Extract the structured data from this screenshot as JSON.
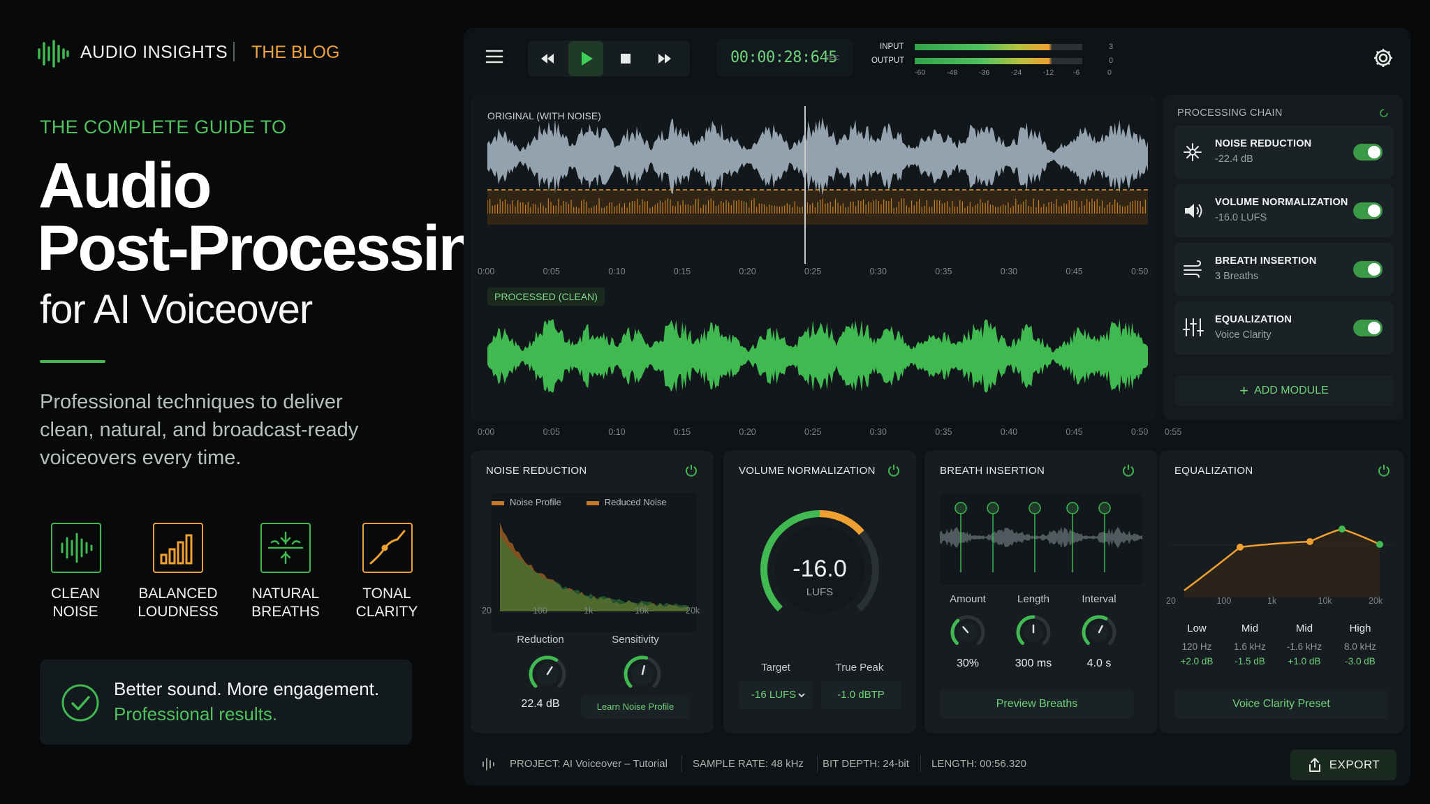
{
  "brand": {
    "name": "AUDIO INSIGHTS",
    "section": "THE BLOG"
  },
  "hero": {
    "kicker": "THE COMPLETE GUIDE TO",
    "title_line1": "Audio",
    "title_line2": "Post-Processing",
    "title_line3": "for AI Voiceover",
    "description_lines": [
      "Professional techniques to deliver",
      "clean, natural, and broadcast-ready",
      "voiceovers every time."
    ]
  },
  "features": [
    {
      "line1": "CLEAN",
      "line2": "NOISE",
      "icon": "waveform-icon",
      "color": "#3fb950"
    },
    {
      "line1": "BALANCED",
      "line2": "LOUDNESS",
      "icon": "bars-icon",
      "color": "#f0a030"
    },
    {
      "line1": "NATURAL",
      "line2": "BREATHS",
      "icon": "breath-icon",
      "color": "#3fb950"
    },
    {
      "line1": "TONAL",
      "line2": "CLARITY",
      "icon": "eq-curve-icon",
      "color": "#f0a030"
    }
  ],
  "callout": {
    "line1": "Better sound. More engagement.",
    "line2": "Professional results."
  },
  "transport": {
    "time": "00:00:28:645",
    "time_unit": "SEC",
    "meter_labels": [
      "INPUT",
      "OUTPUT"
    ],
    "meter_values": [
      "3",
      "0"
    ],
    "meter_scale": [
      "-60",
      "-48",
      "-36",
      "-24",
      "-12",
      "-6",
      "0"
    ]
  },
  "waveforms": {
    "original_label": "ORIGINAL (WITH NOISE)",
    "processed_label": "PROCESSED (CLEAN)",
    "original_ticks": [
      "0:00",
      "0:05",
      "0:10",
      "0:15",
      "0:20",
      "0:25",
      "0:30",
      "0:35",
      "0:30",
      "0:45",
      "0:50"
    ],
    "processed_ticks": [
      "0:00",
      "0:05",
      "0:10",
      "0:15",
      "0:20",
      "0:25",
      "0:30",
      "0:35",
      "0:40",
      "0:45",
      "0:50"
    ],
    "extra_tick": "0:55"
  },
  "chain": {
    "title": "PROCESSING CHAIN",
    "items": [
      {
        "name": "NOISE REDUCTION",
        "value": "-22.4 dB",
        "icon": "sparkle-icon",
        "enabled": true
      },
      {
        "name": "VOLUME NORMALIZATION",
        "value": "-16.0 LUFS",
        "icon": "speaker-icon",
        "enabled": true
      },
      {
        "name": "BREATH INSERTION",
        "value": "3 Breaths",
        "icon": "wind-icon",
        "enabled": true
      },
      {
        "name": "EQUALIZATION",
        "value": "Voice Clarity",
        "icon": "sliders-icon",
        "enabled": true
      }
    ],
    "add_label": "ADD MODULE"
  },
  "noise": {
    "title": "NOISE REDUCTION",
    "legend": [
      "Noise Profile",
      "Reduced Noise"
    ],
    "ticks": [
      "20",
      "100",
      "1k",
      "10k",
      "20k"
    ],
    "knobs": [
      {
        "label": "Reduction",
        "value": "22.4 dB"
      },
      {
        "label": "Sensitivity",
        "value": ""
      }
    ],
    "button": "Learn Noise Profile"
  },
  "volume": {
    "title": "VOLUME NORMALIZATION",
    "value": "-16.0",
    "unit": "LUFS",
    "target_label": "Target",
    "target_value": "-16 LUFS",
    "peak_label": "True Peak",
    "peak_value": "-1.0 dBTP"
  },
  "breath": {
    "title": "BREATH INSERTION",
    "knobs": [
      {
        "label": "Amount",
        "value": "30%"
      },
      {
        "label": "Length",
        "value": "300 ms"
      },
      {
        "label": "Interval",
        "value": "4.0 s"
      }
    ],
    "button": "Preview Breaths"
  },
  "eq": {
    "title": "EQUALIZATION",
    "ticks": [
      "20",
      "100",
      "1k",
      "10k",
      "20k"
    ],
    "bands": [
      {
        "name": "Low",
        "freq": "120 Hz",
        "gain": "+2.0 dB"
      },
      {
        "name": "Mid",
        "freq": "1.6 kHz",
        "gain": "-1.5 dB"
      },
      {
        "name": "Mid",
        "freq": "-1.6 kHz",
        "gain": "+1.0 dB"
      },
      {
        "name": "High",
        "freq": "8.0 kHz",
        "gain": "-3.0 dB"
      }
    ],
    "button": "Voice Clarity Preset"
  },
  "status": {
    "project": "PROJECT: AI Voiceover – Tutorial",
    "sample_rate": "SAMPLE RATE: 48 kHz",
    "bit_depth": "BIT DEPTH: 24-bit",
    "length": "LENGTH: 00:56.320",
    "export": "EXPORT"
  },
  "colors": {
    "green": "#3fb950",
    "orange": "#f0a030",
    "bg": "#07090b",
    "panel": "#161c20"
  }
}
